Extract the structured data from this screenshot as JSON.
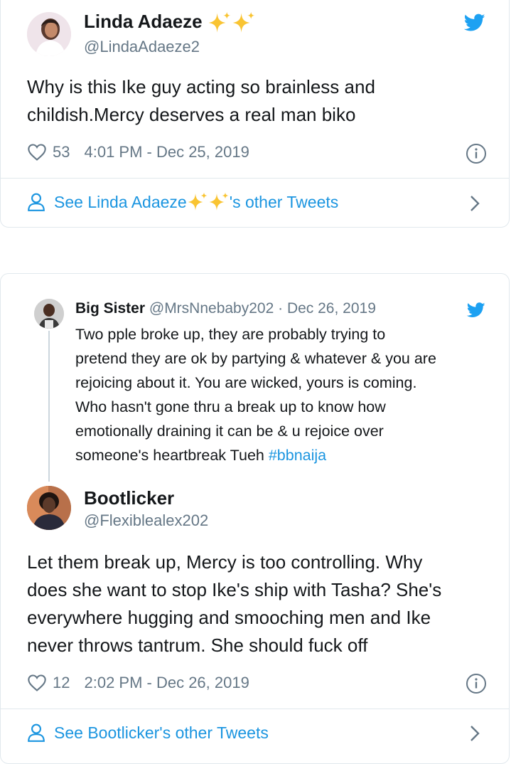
{
  "tweet1": {
    "author_name": "Linda Adaeze",
    "author_handle": "@LindaAdaeze2",
    "text_line1": "Why is this Ike guy acting so brainless and",
    "text_line2": "childish.Mercy deserves a real man biko",
    "likes": "53",
    "timestamp": "4:01 PM - Dec 25, 2019",
    "see_other_prefix": "See Linda Adaeze",
    "see_other_suffix": "'s other Tweets"
  },
  "tweet2": {
    "quoted": {
      "author_name": "Big Sister",
      "author_handle": "@MrsNnebaby202",
      "date": "· Dec 26, 2019",
      "lines": [
        "Two pple broke up, they are probably trying to",
        "pretend they are ok by partying & whatever & you are",
        "rejoicing about it. You are wicked, yours is coming.",
        "Who hasn't gone thru a break up to know how",
        "emotionally draining it can be & u rejoice over"
      ],
      "last_line_text": "someone's heartbreak Tueh ",
      "hashtag": "#bbnaija"
    },
    "author_name": "Bootlicker",
    "author_handle": "@Flexiblealex202",
    "lines": [
      "Let them break up, Mercy is too controlling. Why",
      "does she want to stop Ike's ship with Tasha? She's",
      "everywhere hugging and smooching men and Ike",
      "never throws tantrum. She should fuck off"
    ],
    "likes": "12",
    "timestamp": "2:02 PM - Dec 26, 2019",
    "see_other": "See Bootlicker's other Tweets"
  },
  "icons": {
    "twitter_bird": "twitter-bird-icon",
    "heart": "heart-icon",
    "info": "info-icon",
    "person": "person-icon",
    "chevron": "chevron-right-icon",
    "sparkle": "sparkles-emoji"
  },
  "colors": {
    "twitter_blue": "#1da1f2",
    "link_blue": "#1b95e0",
    "muted_gray": "#657786",
    "border": "#e1e8ed",
    "sparkle_gold": "#f9c432"
  }
}
